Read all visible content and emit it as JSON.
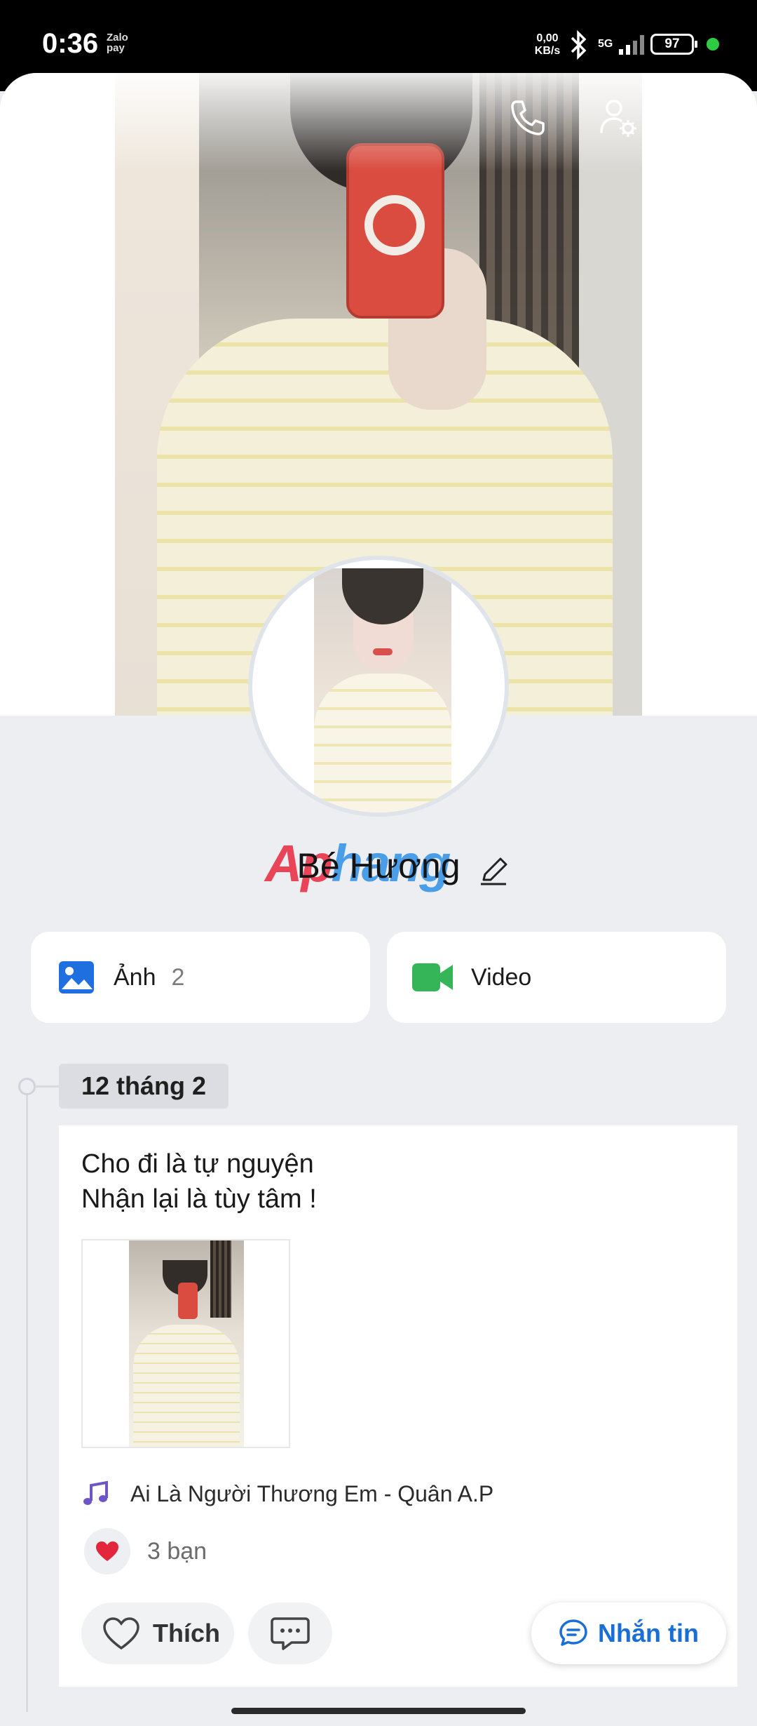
{
  "status_bar": {
    "time": "0:36",
    "zalopay": "Zalo pay",
    "speed_value": "0,00",
    "speed_unit": "KB/s",
    "network": "5G",
    "battery": "97"
  },
  "header": {
    "back_icon": "arrow-left-icon",
    "call_icon": "phone-icon",
    "settings_icon": "user-settings-icon",
    "more_icon": "more-dots-icon"
  },
  "profile": {
    "name": "Bé Hương",
    "watermark_a": "Ap",
    "watermark_b": "hang"
  },
  "media": {
    "photos_label": "Ảnh",
    "photos_count": "2",
    "video_label": "Video"
  },
  "timeline": {
    "date": "12 tháng 2",
    "post": {
      "line1": "Cho đi là tự nguyện",
      "line2": "Nhận lại là tùy tâm !",
      "music": "Ai Là Người Thương Em - Quân A.P",
      "reactions": "3 bạn",
      "like_label": "Thích"
    }
  },
  "message_button": "Nhắn tin",
  "colors": {
    "accent": "#1a6fd6",
    "photo_icon": "#1f6fe0",
    "video_icon": "#35b558",
    "heart": "#e3263b",
    "music_note": "#6f56c8"
  }
}
